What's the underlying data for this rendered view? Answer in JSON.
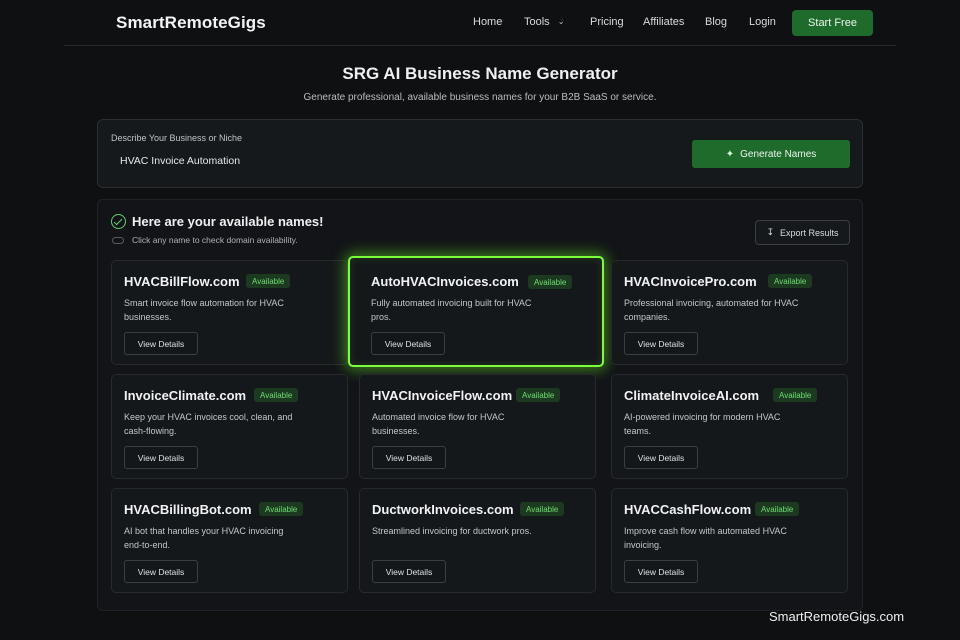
{
  "nav": {
    "logo": "SmartRemoteGigs",
    "links": [
      "Home",
      "Tools",
      "Pricing",
      "Affiliates",
      "Blog",
      "Login"
    ],
    "cta": "Start Free"
  },
  "header": {
    "title": "SRG AI Business Name Generator",
    "subtitle": "Generate professional, available business names for your B2B SaaS or service."
  },
  "input": {
    "label": "Describe Your Business or Niche",
    "value": "HVAC Invoice Automation",
    "button": "Generate Names"
  },
  "results": {
    "title": "Here are your available names!",
    "hint": "Click any name to check domain availability.",
    "export": "Export Results",
    "view_details": "View Details",
    "cards": [
      {
        "name": "HVACBillFlow.com",
        "status": "Available",
        "desc": "Smart invoice flow automation for HVAC businesses.",
        "selected": false
      },
      {
        "name": "AutoHVACInvoices.com",
        "status": "Available",
        "desc": "Fully automated invoicing built for HVAC pros.",
        "selected": true
      },
      {
        "name": "HVACInvoicePro.com",
        "status": "Available",
        "desc": "Professional invoicing, automated for HVAC companies.",
        "selected": false
      },
      {
        "name": "InvoiceClimate.com",
        "status": "Available",
        "desc": "Keep your HVAC invoices cool, clean, and cash-flowing.",
        "selected": false
      },
      {
        "name": "HVACInvoiceFlow.com",
        "status": "Available",
        "desc": "Automated invoice flow for HVAC businesses.",
        "selected": false
      },
      {
        "name": "ClimateInvoiceAI.com",
        "status": "Available",
        "desc": "AI-powered invoicing for modern HVAC teams.",
        "selected": false
      },
      {
        "name": "HVACBillingBot.com",
        "status": "Available",
        "desc": "AI bot that handles your HVAC invoicing end-to-end.",
        "selected": false
      },
      {
        "name": "DuctworkInvoices.com",
        "status": "Available",
        "desc": "Streamlined invoicing for ductwork pros.",
        "selected": false
      },
      {
        "name": "HVACCashFlow.com",
        "status": "Available",
        "desc": "Improve cash flow with automated HVAC invoicing.",
        "selected": false
      }
    ]
  },
  "watermark": "SmartRemoteGigs.com",
  "colors": {
    "accent": "#1f6b2c",
    "highlight": "#7cff3a",
    "badge_text": "#6fdc74",
    "background": "#0e1012"
  }
}
